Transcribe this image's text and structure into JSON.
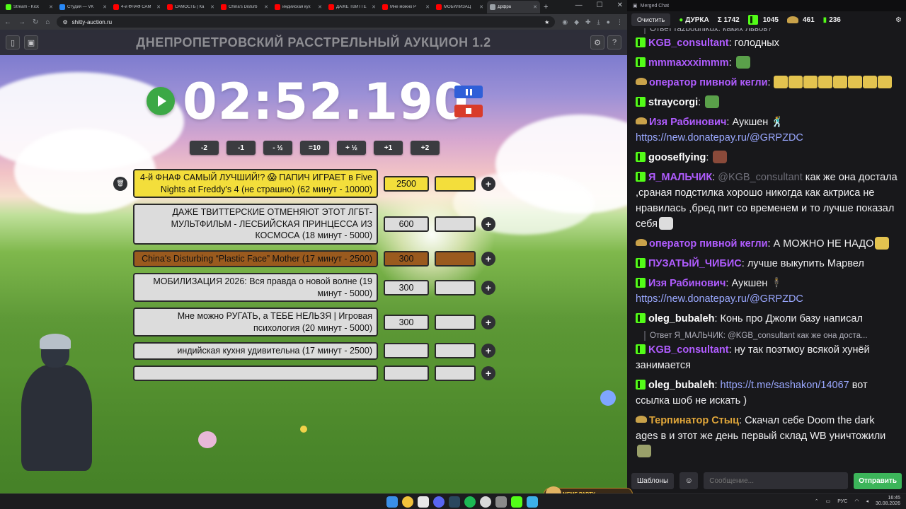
{
  "browser": {
    "tabs": [
      {
        "title": "Stream - Kick",
        "color": "#53fc18",
        "active": false
      },
      {
        "title": "Студия — VK",
        "color": "#2787f5",
        "active": false
      },
      {
        "title": "4-й ФНАФ САМ",
        "color": "#ff0000",
        "active": false
      },
      {
        "title": "САМОСТЬ | Ка",
        "color": "#ff0000",
        "active": false
      },
      {
        "title": "China's Disturb",
        "color": "#ff0000",
        "active": false
      },
      {
        "title": "индийская кух",
        "color": "#ff0000",
        "active": false
      },
      {
        "title": "ДАЖЕ ТВИТТЕ",
        "color": "#ff0000",
        "active": false
      },
      {
        "title": "Мне можно Р",
        "color": "#ff0000",
        "active": false
      },
      {
        "title": "МОБИЛИЗАЦ",
        "color": "#ff0000",
        "active": false
      },
      {
        "title": "Дрфра",
        "color": "#9aa0a6",
        "active": true
      }
    ],
    "url": "shitty-auction.ru"
  },
  "auction": {
    "title": "ДНЕПРОПЕТРОВСКИЙ РАССТРЕЛЬНЫЙ АУКЦИОН 1.2",
    "timer": "02:52.190",
    "adjust_buttons": [
      "-2",
      "-1",
      "- ½",
      "=10",
      "+ ½",
      "+1",
      "+2"
    ],
    "lots": [
      {
        "name": "4-й ФНАФ САМЫЙ ЛУЧШИЙ!? 😱 ПАПИЧ ИГРАЕТ в Five Nights at Freddy's 4 (не страшно) (62 минут - 10000)",
        "amount": "2500",
        "color": "#f3de3b",
        "deletable": true
      },
      {
        "name": "ДАЖЕ ТВИТТЕРСКИЕ ОТМЕНЯЮТ ЭТОТ ЛГБТ-МУЛЬТФИЛЬМ - ЛЕСБИЙСКАЯ ПРИНЦЕССА ИЗ КОСМОСА (18 минут - 5000)",
        "amount": "600",
        "color": "#dcdcdc"
      },
      {
        "name": "China's Disturbing “Plastic Face” Mother (17 минут - 2500)",
        "amount": "300",
        "color": "#9a5a1e"
      },
      {
        "name": "МОБИЛИЗАЦИЯ 2026: Вся правда о новой волне (19 минут - 5000)",
        "amount": "300",
        "color": "#dcdcdc"
      },
      {
        "name": "Мне можно РУГАТЬ, а ТЕБЕ НЕЛЬЗЯ | Игровая психология (20 минут - 5000)",
        "amount": "300",
        "color": "#dcdcdc"
      },
      {
        "name": "индийская кухня удивительна (17 минут - 2500)",
        "amount": "",
        "color": "#dcdcdc"
      },
      {
        "name": "",
        "amount": "",
        "color": "#dcdcdc"
      }
    ]
  },
  "chat": {
    "window_title": "Merged Chat",
    "clear_label": "Очистить",
    "channel": "ДУРКА",
    "stats": [
      "Σ 1742",
      "1045",
      "461",
      "236"
    ],
    "top_reply": "Ответ razbounikux: каких львов?",
    "messages": [
      {
        "user": "KGB_consultant",
        "color": "#b05cff",
        "badge": "kick",
        "text": "голодных"
      },
      {
        "user": "mmmaxxximmm",
        "color": "#b05cff",
        "badge": "kick",
        "text": "",
        "emote": "#5aa04a"
      },
      {
        "user": "оператор пивной кегли",
        "color": "#b05cff",
        "badge": "hat",
        "text": "",
        "emote_row": 8
      },
      {
        "user": "straycorgi",
        "color": "#ffffff",
        "badge": "kick",
        "text": "",
        "emote": "#5aa04a"
      },
      {
        "user": "Изя Рабинович",
        "color": "#b05cff",
        "badge": "hat",
        "text": "Аукшен 🕺",
        "link": "https://new.donatepay.ru/@GRPZDC"
      },
      {
        "user": "gooseflying",
        "color": "#ffffff",
        "badge": "kick",
        "text": "",
        "emote": "#8a4a3a"
      },
      {
        "user": "Я_МАЛЬЧИК",
        "color": "#b05cff",
        "badge": "kick",
        "mention": "@KGB_consultant",
        "text": "как же она достала ,сраная подстилка хорошо никогда как актриса не нравилась ,бред пит со временем и то лучше показал себя",
        "emote": "#dddddd"
      },
      {
        "user": "оператор пивной кегли",
        "color": "#b05cff",
        "badge": "hat",
        "text": "А МОЖНО НЕ НАДО",
        "emote": "#e3c34f"
      },
      {
        "user": "ПУЗАТЫЙ_ЧИБИС",
        "color": "#b05cff",
        "badge": "kick",
        "text": "лучше выкупить Марвел"
      },
      {
        "user": "Изя Рабинович",
        "color": "#b05cff",
        "badge": "kick",
        "text": "Аукшен 🕴",
        "link": "https://new.donatepay.ru/@GRPZDC"
      },
      {
        "user": "oleg_bubaleh",
        "color": "#ffffff",
        "badge": "kick",
        "text": "Конь про Джоли базу написал"
      },
      {
        "reply": "Ответ Я_МАЛЬЧИК: @KGB_consultant как же она доста...",
        "user": "KGB_consultant",
        "color": "#b05cff",
        "badge": "kick",
        "text": "ну так поэтмоу всякой хунёй занимается"
      },
      {
        "user": "oleg_bubaleh",
        "color": "#ffffff",
        "badge": "kick",
        "link_first": "https://t.me/sashakon/14067",
        "text": "вот ссылка шоб не искать )"
      },
      {
        "user": "Терпинатор Стыц",
        "color": "#e0a63a",
        "badge": "hat",
        "text": "Скачал себе Doom the dark ages в и этот же день первый склад WB уничтожили",
        "emote": "#9aa06a"
      }
    ],
    "templates_label": "Шаблоны",
    "input_placeholder": "Сообщение...",
    "send_label": "Отправить"
  },
  "taskbar": {
    "lang": "РУС",
    "time": "16:45",
    "date": "30.08.2026",
    "meme_label": "MEME PARTY"
  }
}
